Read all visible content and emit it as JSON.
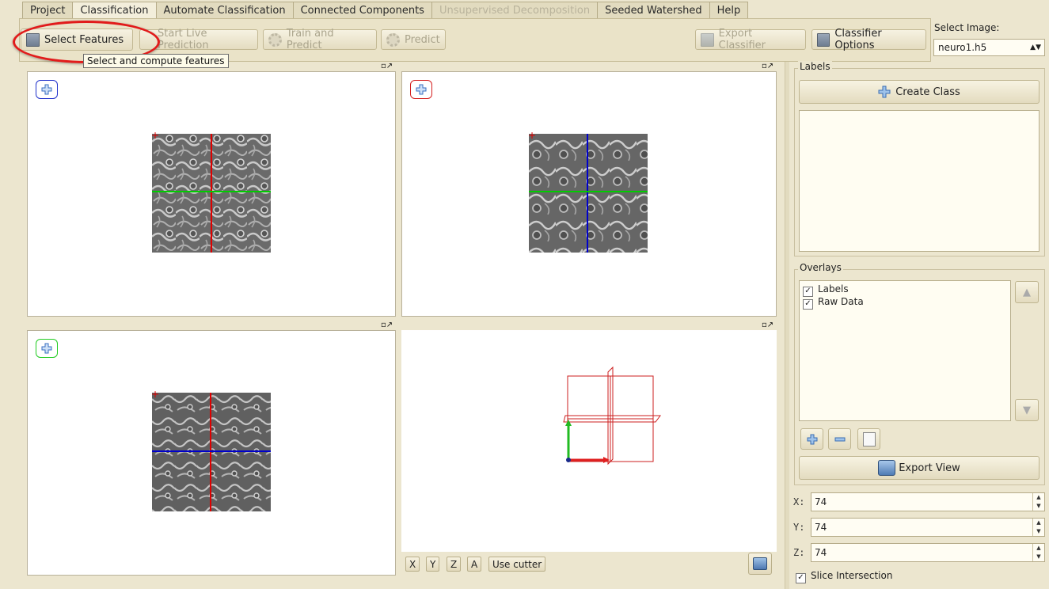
{
  "tabs": [
    {
      "label": "Project",
      "state": "normal"
    },
    {
      "label": "Classification",
      "state": "active"
    },
    {
      "label": "Automate Classification",
      "state": "normal"
    },
    {
      "label": "Connected Components",
      "state": "normal"
    },
    {
      "label": "Unsupervised Decomposition",
      "state": "disabled"
    },
    {
      "label": "Seeded Watershed",
      "state": "normal"
    },
    {
      "label": "Help",
      "state": "normal"
    }
  ],
  "toolbar": {
    "select_features": "Select Features",
    "start_live_prediction": "Start Live Prediction",
    "train_and_predict": "Train and Predict",
    "predict": "Predict",
    "export_classifier": "Export Classifier",
    "classifier_options": "Classifier Options"
  },
  "tooltip": "Select and compute features",
  "image_select": {
    "label": "Select Image:",
    "value": "neuro1.h5"
  },
  "viewer3d": {
    "buttons": [
      "X",
      "Y",
      "Z",
      "A"
    ],
    "use_cutter": "Use cutter"
  },
  "labels_panel": {
    "title": "Labels",
    "create_class": "Create Class"
  },
  "overlays_panel": {
    "title": "Overlays",
    "items": [
      {
        "label": "Labels",
        "checked": true
      },
      {
        "label": "Raw Data",
        "checked": true
      }
    ],
    "export_view": "Export View"
  },
  "coords": {
    "x_label": "X:",
    "x": "74",
    "y_label": "Y:",
    "y": "74",
    "z_label": "Z:",
    "z": "74"
  },
  "slice_intersection": {
    "label": "Slice Intersection",
    "checked": true
  },
  "colors": {
    "axis_x": "#e00000",
    "axis_y": "#00cc00",
    "axis_z": "#0000cc",
    "highlight": "#e11b1b"
  }
}
